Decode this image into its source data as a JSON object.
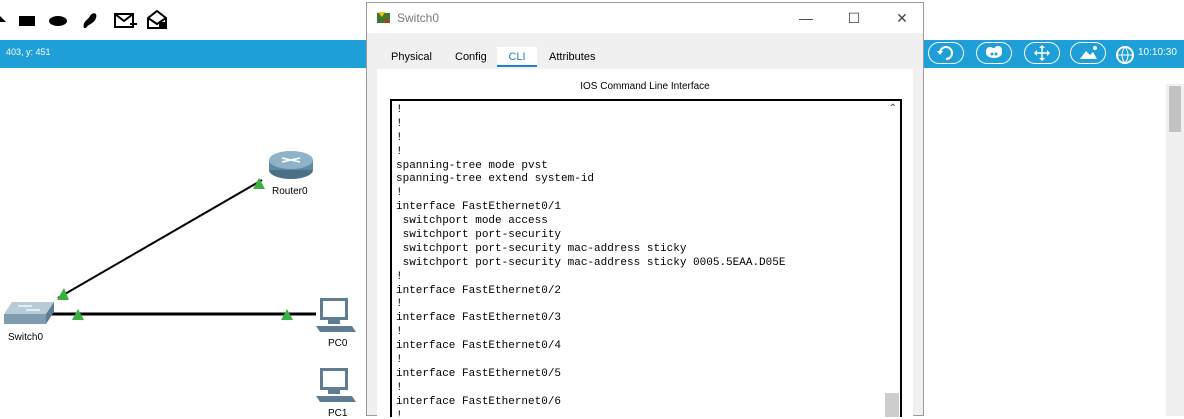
{
  "status": {
    "coords": "403, y: 451",
    "time": "10:10:30"
  },
  "devices": {
    "router": "Router0",
    "switch": "Switch0",
    "pc0": "PC0",
    "pc1": "PC1"
  },
  "dialog": {
    "title": "Switch0",
    "tabs": [
      "Physical",
      "Config",
      "CLI",
      "Attributes"
    ],
    "active_tab": "CLI",
    "panel_title": "IOS Command Line Interface",
    "cli_lines": [
      "!",
      "!",
      "!",
      "!",
      "spanning-tree mode pvst",
      "spanning-tree extend system-id",
      "!",
      "interface FastEthernet0/1",
      " switchport mode access",
      " switchport port-security",
      " switchport port-security mac-address sticky",
      " switchport port-security mac-address sticky 0005.5EAA.D05E",
      "!",
      "interface FastEthernet0/2",
      "!",
      "interface FastEthernet0/3",
      "!",
      "interface FastEthernet0/4",
      "!",
      "interface FastEthernet0/5",
      "!",
      "interface FastEthernet0/6",
      "!"
    ]
  },
  "colors": {
    "accent": "#1e9fd8",
    "link_green": "#3cb043",
    "tab_active": "#1e7fd0"
  }
}
